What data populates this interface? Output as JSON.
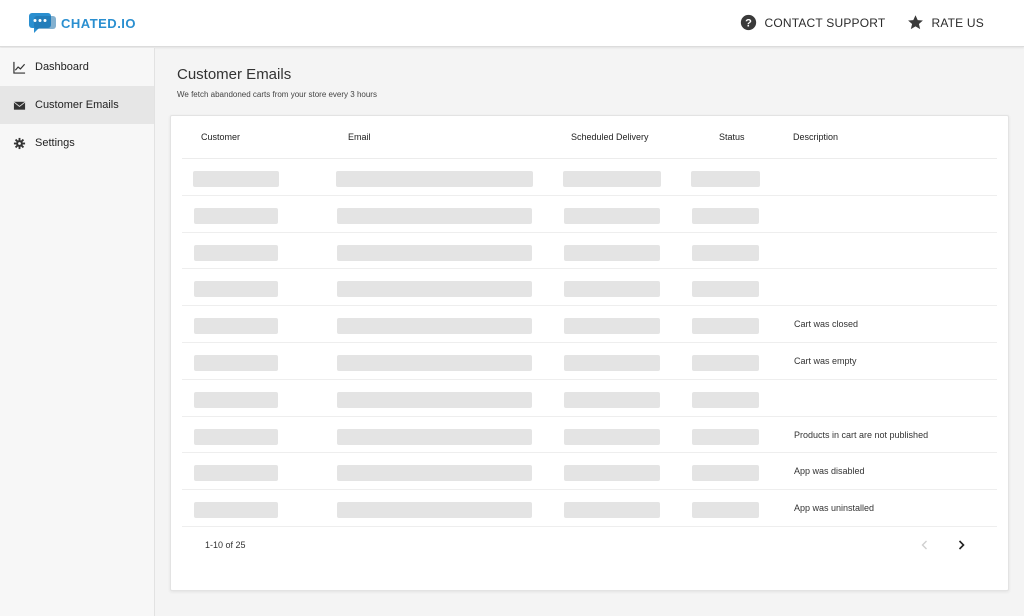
{
  "brand": {
    "name": "CHATED.IO",
    "color": "#2a8fd0"
  },
  "header": {
    "actions": [
      {
        "label": "CONTACT SUPPORT",
        "icon": "help-circle-icon"
      },
      {
        "label": "RATE US",
        "icon": "star-icon"
      }
    ]
  },
  "sidebar": {
    "items": [
      {
        "label": "Dashboard",
        "icon": "chart-line-icon",
        "active": false
      },
      {
        "label": "Customer Emails",
        "icon": "envelope-icon",
        "active": true
      },
      {
        "label": "Settings",
        "icon": "gear-icon",
        "active": false
      }
    ]
  },
  "main": {
    "title": "Customer Emails",
    "subtitle": "We fetch abandoned carts from your store every 3 hours"
  },
  "table": {
    "columns": [
      "Customer",
      "Email",
      "Scheduled Delivery",
      "Status",
      "Description"
    ],
    "rows": [
      {
        "description": ""
      },
      {
        "description": ""
      },
      {
        "description": ""
      },
      {
        "description": ""
      },
      {
        "description": "Cart was closed"
      },
      {
        "description": "Cart was empty"
      },
      {
        "description": ""
      },
      {
        "description": "Products in cart are not published"
      },
      {
        "description": "App was disabled"
      },
      {
        "description": "App was uninstalled"
      }
    ]
  },
  "pagination": {
    "summary": "1-10 of 25"
  }
}
